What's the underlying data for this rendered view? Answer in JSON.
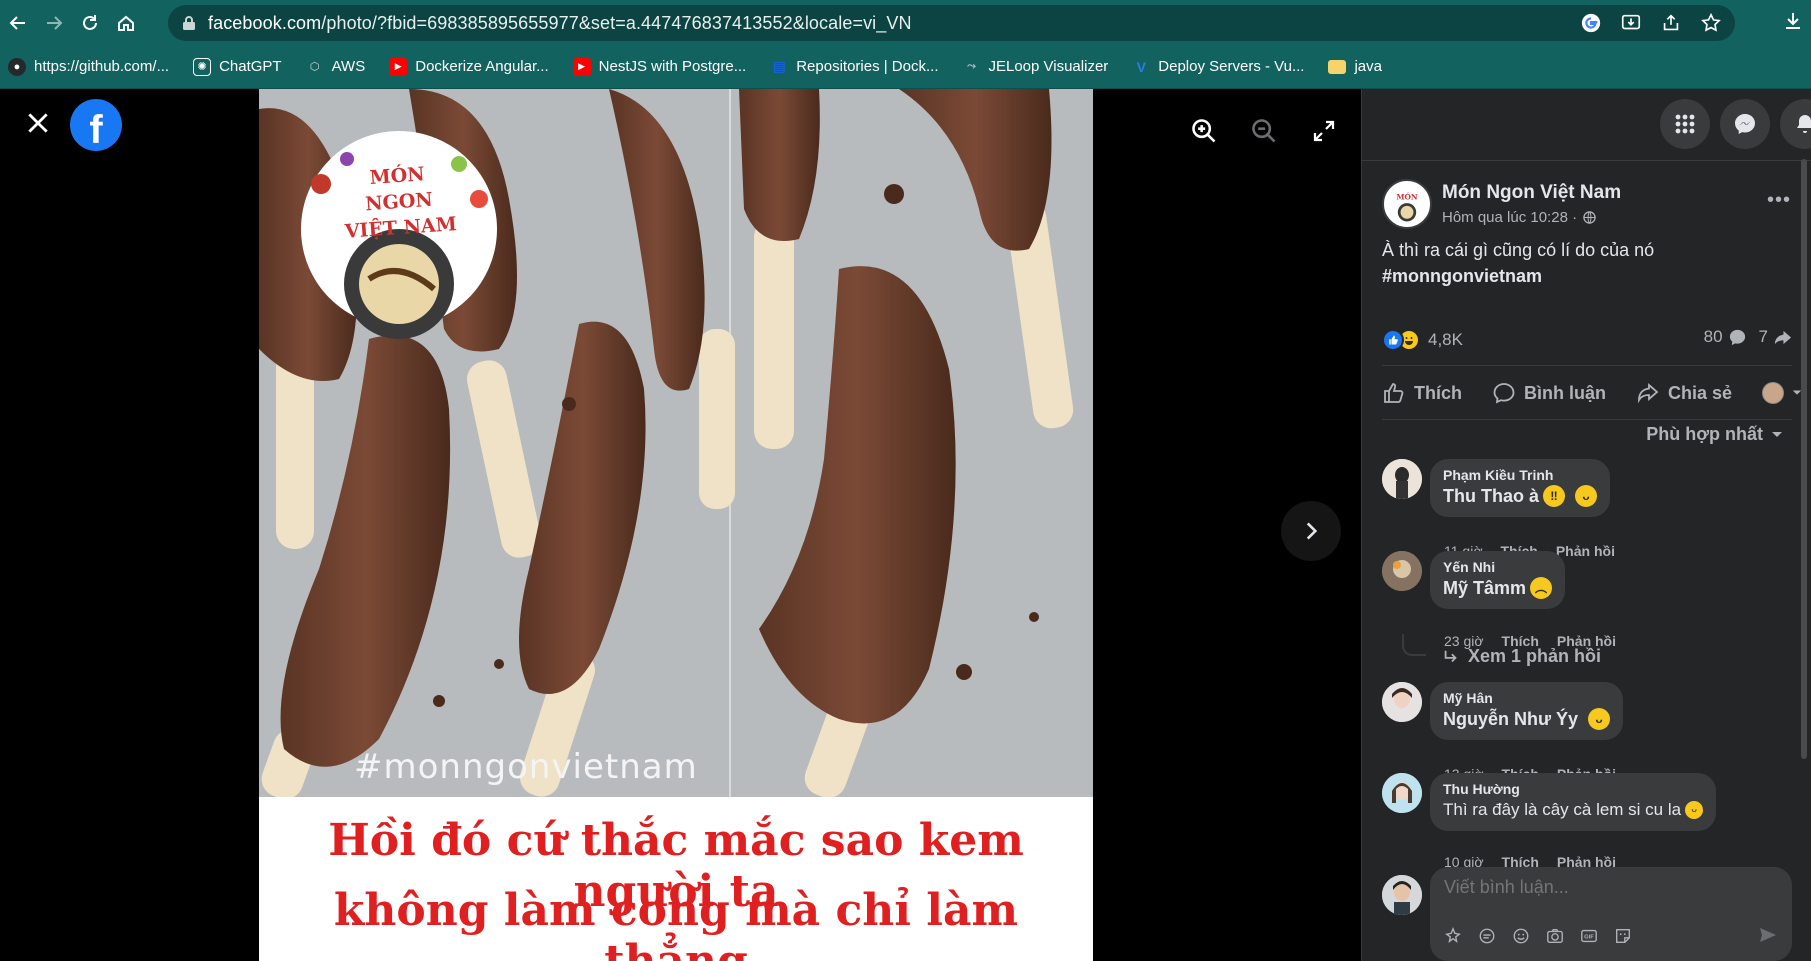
{
  "browser": {
    "url_domain": "facebook.com",
    "url_path": "/photo/?fbid=698385895655977&set=a.447476837413552&locale=vi_VN"
  },
  "bookmarks": [
    {
      "label": "https://github.com/...",
      "icon": "github-icon",
      "color": "#ffffff"
    },
    {
      "label": "ChatGPT",
      "icon": "chatgpt-icon",
      "color": "#ffffff"
    },
    {
      "label": "AWS",
      "icon": "aws-cube-icon",
      "color": "#cfd8dc"
    },
    {
      "label": "Dockerize Angular...",
      "icon": "youtube-icon",
      "color": "#ff0000"
    },
    {
      "label": "NestJS with Postgre...",
      "icon": "youtube-icon",
      "color": "#ff0000"
    },
    {
      "label": "Repositories | Dock...",
      "icon": "docker-icon",
      "color": "#1d63ed"
    },
    {
      "label": "JELoop Visualizer",
      "icon": "visualizer-icon",
      "color": "#90a4ae"
    },
    {
      "label": "Deploy Servers - Vu...",
      "icon": "vultr-icon",
      "color": "#2b7de9"
    },
    {
      "label": "java",
      "icon": "folder-icon",
      "color": "#f6d36b"
    }
  ],
  "photo": {
    "watermark": "#monngonvietnam",
    "logo_text": "MÓN NGON VIỆT NAM",
    "caption_line1": "Hồi đó cứ thắc mắc sao kem người ta",
    "caption_line2": "không làm cong mà chỉ làm thẳng"
  },
  "post": {
    "page_name": "Món Ngon Việt Nam",
    "time": "Hôm qua lúc 10:28 ·",
    "text": "À thì ra cái gì cũng có lí do của nó",
    "hashtag": "#monngonvietnam",
    "reaction_count": "4,8K",
    "comment_count": "80",
    "share_count": "7"
  },
  "actions": {
    "like": "Thích",
    "comment": "Bình luận",
    "share": "Chia sẻ",
    "sort": "Phù hợp nhất"
  },
  "comments": [
    {
      "author": "Phạm Kiều Trinh",
      "text": "Thu Thao à",
      "time": "11 giờ",
      "like": "Thích",
      "reply": "Phản hồi"
    },
    {
      "author": "Yến Nhi",
      "text": "Mỹ Tâmm",
      "time": "23 giờ",
      "like": "Thích",
      "reply": "Phản hồi"
    },
    {
      "author": "Mỹ Hân",
      "text": "Nguyễn Như Ýy",
      "time": "13 giờ",
      "like": "Thích",
      "reply": "Phản hồi"
    },
    {
      "author": "Thu Hường",
      "text": "Thì ra đây là cây cà lem si cu la",
      "time": "10 giờ",
      "like": "Thích",
      "reply": "Phản hồi"
    }
  ],
  "replies_link": "Xem 1 phản hồi",
  "composer_placeholder": "Viết bình luận...",
  "colors": {
    "chrome": "#12625f",
    "panel": "#242526",
    "bubble": "#3a3b3c",
    "caption_red": "#e02020",
    "fb_blue": "#1877f2"
  }
}
